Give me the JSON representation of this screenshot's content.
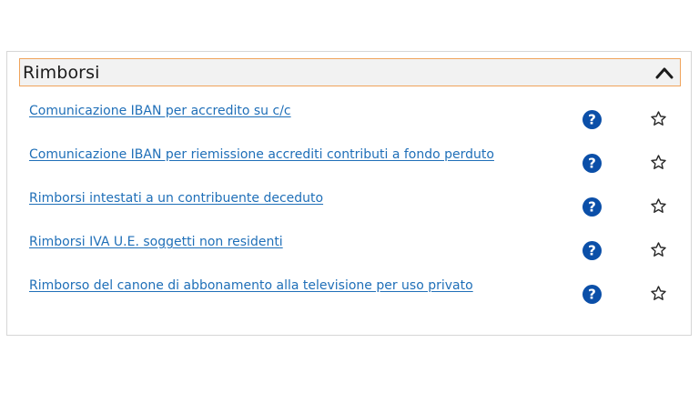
{
  "section": {
    "title": "Rimborsi",
    "expanded": true
  },
  "items": [
    {
      "label": "Comunicazione IBAN per accredito su c/c"
    },
    {
      "label": "Comunicazione IBAN per riemissione accrediti contributi a fondo perduto"
    },
    {
      "label": "Rimborsi intestati a un contribuente deceduto"
    },
    {
      "label": "Rimborsi IVA U.E. soggetti non residenti"
    },
    {
      "label": "Rimborso del canone di abbonamento alla televisione per uso privato"
    }
  ],
  "icons": {
    "help": "help-circle-icon",
    "favorite": "star-outline-icon",
    "collapse": "chevron-up-icon"
  },
  "colors": {
    "link": "#1f6fb8",
    "help": "#0b4fa8",
    "header_border": "#f0a35a",
    "header_bg": "#f2f2f2"
  }
}
